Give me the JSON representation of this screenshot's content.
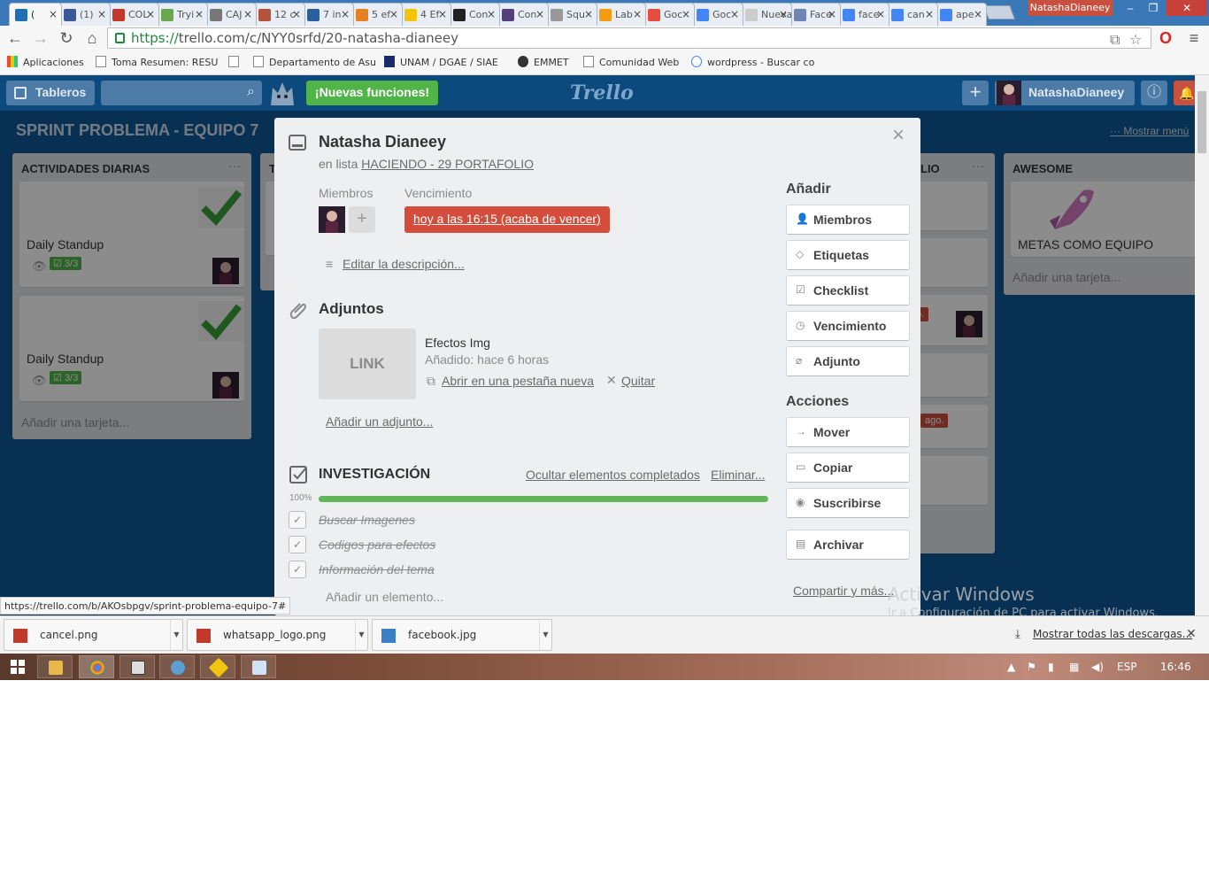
{
  "browser": {
    "tabs": [
      {
        "label": "(",
        "active": true,
        "color": "#1f6fb5"
      },
      {
        "label": "(1)",
        "color": "#3b5998"
      },
      {
        "label": "COL",
        "color": "#c0392b"
      },
      {
        "label": "Tryi",
        "color": "#6aa84f"
      },
      {
        "label": "CAJ",
        "color": "#777777"
      },
      {
        "label": "12 c",
        "color": "#b5533c"
      },
      {
        "label": "7 in",
        "color": "#2a5f9e"
      },
      {
        "label": "5 ef",
        "color": "#e67e22"
      },
      {
        "label": "4 Ef",
        "color": "#f1c40f"
      },
      {
        "label": "Con",
        "color": "#222222"
      },
      {
        "label": "Con",
        "color": "#563d7c"
      },
      {
        "label": "Squ",
        "color": "#999999"
      },
      {
        "label": "Lab",
        "color": "#f39c12"
      },
      {
        "label": "Goc",
        "color": "#e74c3c"
      },
      {
        "label": "Goc",
        "color": "#4285f4"
      },
      {
        "label": "Nueva",
        "color": "#cccccc"
      },
      {
        "label": "Face",
        "color": "#6d84b4"
      },
      {
        "label": "face",
        "color": "#4285f4"
      },
      {
        "label": "can",
        "color": "#4285f4"
      },
      {
        "label": "ape",
        "color": "#4285f4"
      }
    ],
    "window_user": "NatashaDianeey",
    "url_scheme": "https://",
    "url_rest": "trello.com/c/NYY0srfd/20-natasha-dianeey",
    "bookmarks": [
      "Aplicaciones",
      "Toma Resumen: RESU",
      "",
      "Departamento de Asu",
      "UNAM / DGAE / SIAE",
      "EMMET",
      "Comunidad Web",
      "wordpress - Buscar co"
    ],
    "status_url": "https://trello.com/b/AKOsbpgv/sprint-problema-equipo-7#",
    "downloads": [
      "cancel.png",
      "whatsapp_logo.png",
      "facebook.jpg"
    ],
    "show_all_downloads": "Mostrar todas las descargas...",
    "watermark_title": "Activar Windows",
    "watermark_sub": "Ir a Configuración de PC para activar Windows."
  },
  "trello": {
    "boards_button": "Tableros",
    "new_features": "¡Nuevas funciones!",
    "logo": "Trello",
    "username": "NatashaDianeey",
    "board_name": "SPRINT PROBLEMA - EQUIPO 7",
    "show_menu": "Mostrar menú",
    "lists": {
      "daily": {
        "title": "ACTIVIDADES DIARIAS",
        "cards": [
          {
            "title": "Daily Standup",
            "checklist": "3/3"
          },
          {
            "title": "Daily Standup",
            "checklist": "3/3"
          }
        ],
        "add_card": "Añadir una tarjeta..."
      },
      "partial_title": "T",
      "portfolio_partial": "LIO",
      "awesome": {
        "title": "AWESOME",
        "card_title": "METAS COMO EQUIPO",
        "add_card": "Añadir una tarjeta..."
      },
      "ago_label": "ago.",
      "o_label": "o."
    }
  },
  "modal": {
    "title": "Natasha Dianeey",
    "in_list_prefix": "en lista",
    "list_name": "HACIENDO - 29 PORTAFOLIO",
    "members_label": "Miembros",
    "due_label": "Vencimiento",
    "due_value": "hoy a las 16:15 (acaba de vencer)",
    "due_color": "#d44d3b",
    "edit_description": "Editar la descripción...",
    "attachments_heading": "Adjuntos",
    "attachment": {
      "thumb": "LINK",
      "name": "Efectos Img",
      "added": "Añadido: hace 6 horas",
      "open": "Abrir en una pestaña nueva",
      "remove": "Quitar"
    },
    "add_attachment": "Añadir un adjunto...",
    "checklist": {
      "title": "INVESTIGACIÓN",
      "hide_completed": "Ocultar elementos completados",
      "delete": "Eliminar...",
      "percent": "100%",
      "progress": 1.0,
      "items": [
        "Buscar Imagenes",
        "Codigos para efectos",
        "Información del tema"
      ],
      "add_item": "Añadir un elemento..."
    },
    "sidebar": {
      "add_heading": "Añadir",
      "add_buttons": [
        "Miembros",
        "Etiquetas",
        "Checklist",
        "Vencimiento",
        "Adjunto"
      ],
      "actions_heading": "Acciones",
      "action_buttons": [
        "Mover",
        "Copiar",
        "Suscribirse",
        "Archivar"
      ],
      "share": "Compartir y más..."
    }
  },
  "taskbar": {
    "lang": "ESP",
    "time": "16:46"
  }
}
